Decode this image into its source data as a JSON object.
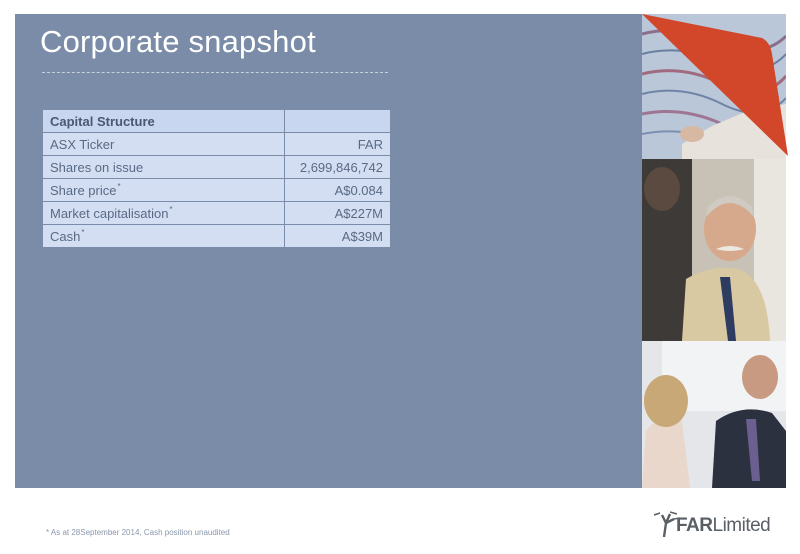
{
  "slide": {
    "title": "Corporate snapshot",
    "footnote": "* As at 28September 2014, Cash position unaudited"
  },
  "table": {
    "header": [
      "Capital Structure",
      ""
    ],
    "rows": [
      {
        "label": "ASX Ticker",
        "star": "",
        "value": "FAR"
      },
      {
        "label": "Shares on issue",
        "star": "",
        "value": "2,699,846,742"
      },
      {
        "label": "Share price",
        "star": "*",
        "value": "A$0.084"
      },
      {
        "label": "Market capitalisation",
        "star": "*",
        "value": "A$227M"
      },
      {
        "label": "Cash",
        "star": "*",
        "value": "A$39M"
      }
    ]
  },
  "logo": {
    "brand_bold": "FAR",
    "brand_light": "Limited"
  },
  "colors": {
    "panel": "#7a8ca8",
    "cell": "#d3def2",
    "accent": "#d2462a"
  },
  "icons": {
    "logo": "tree-icon"
  }
}
